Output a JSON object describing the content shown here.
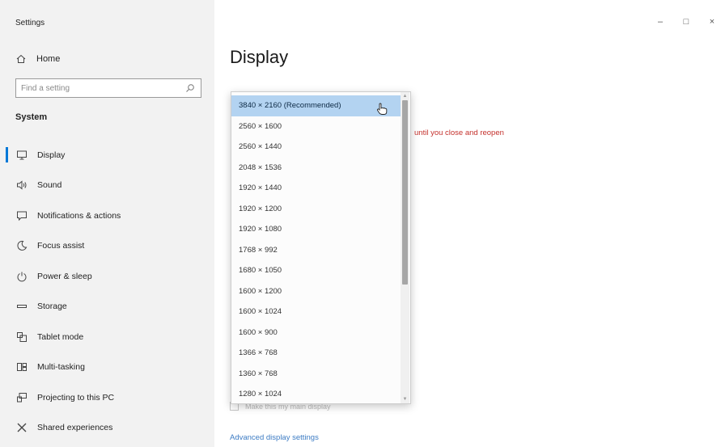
{
  "window": {
    "title": "Settings",
    "controls": [
      "–",
      "□",
      "×"
    ]
  },
  "sidebar": {
    "home_label": "Home",
    "search": {
      "placeholder": "Find a setting",
      "value": ""
    },
    "section_label": "System",
    "items": [
      {
        "label": "Display",
        "icon": "monitor-icon",
        "selected": true
      },
      {
        "label": "Sound",
        "icon": "speaker-icon"
      },
      {
        "label": "Notifications & actions",
        "icon": "notification-icon"
      },
      {
        "label": "Focus assist",
        "icon": "moon-icon"
      },
      {
        "label": "Power & sleep",
        "icon": "power-icon"
      },
      {
        "label": "Storage",
        "icon": "storage-icon"
      },
      {
        "label": "Tablet mode",
        "icon": "tablet-icon"
      },
      {
        "label": "Multi-tasking",
        "icon": "multitasking-icon"
      },
      {
        "label": "Projecting to this PC",
        "icon": "projector-icon"
      },
      {
        "label": "Shared experiences",
        "icon": "shared-icon"
      }
    ]
  },
  "main": {
    "page_title": "Display",
    "warning_text": "until you close and reopen",
    "checkbox_label": "Make this my main display",
    "advanced_link": "Advanced display settings"
  },
  "dropdown": {
    "selected_index": 0,
    "options": [
      "3840 × 2160 (Recommended)",
      "2560 × 1600",
      "2560 × 1440",
      "2048 × 1536",
      "1920 × 1440",
      "1920 × 1200",
      "1920 × 1080",
      "1768 × 992",
      "1680 × 1050",
      "1600 × 1200",
      "1600 × 1024",
      "1600 × 900",
      "1366 × 768",
      "1360 × 768",
      "1280 × 1024"
    ]
  },
  "colors": {
    "accent": "#0078d7",
    "warning": "#c4312d",
    "link": "#3d7cc4",
    "selection": "#b3d3f1"
  }
}
